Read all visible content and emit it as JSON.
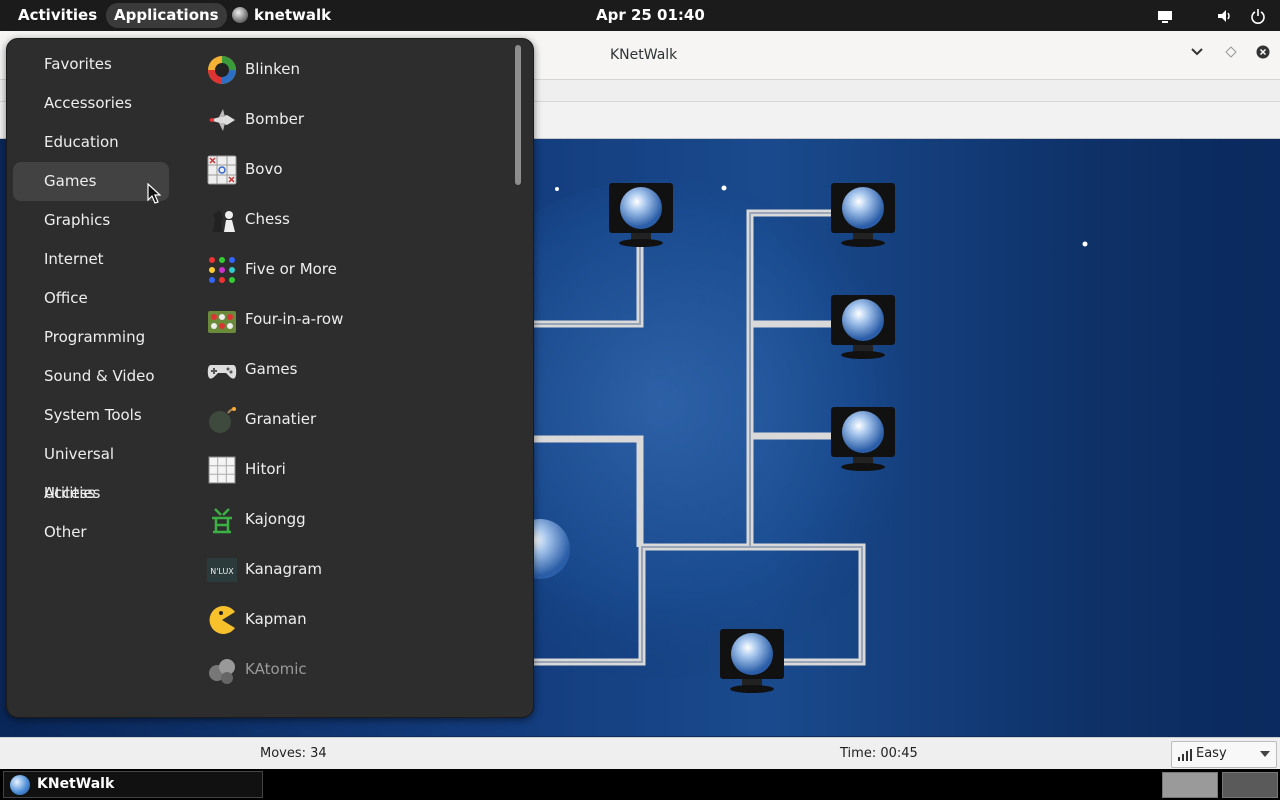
{
  "topbar": {
    "activities": "Activities",
    "applications": "Applications",
    "app_name": "knetwalk",
    "clock": "Apr 25  01:40"
  },
  "window": {
    "title": "KNetWalk",
    "minimize_icon": "chevron-down-icon",
    "maximize_icon": "diamond-icon",
    "close_icon": "close-icon"
  },
  "menu": {
    "categories": [
      "Favorites",
      "Accessories",
      "Education",
      "Games",
      "Graphics",
      "Internet",
      "Office",
      "Programming",
      "Sound & Video",
      "System Tools",
      "Universal Access",
      "Utilities",
      "Other"
    ],
    "selected_category": "Games",
    "apps": [
      "Blinken",
      "Bomber",
      "Bovo",
      "Chess",
      "Five or More",
      "Four-in-a-row",
      "Games",
      "Granatier",
      "Hitori",
      "Kajongg",
      "Kanagram",
      "Kapman",
      "KAtomic"
    ]
  },
  "status": {
    "moves": "Moves: 34",
    "time": "Time: 00:45",
    "difficulty": "Easy"
  },
  "taskbar": {
    "item": "KNetWalk"
  },
  "colors": {
    "topbar": "#1b1b1b",
    "menu_bg": "#2d2d2d",
    "menu_selected": "#424242",
    "board": "#133c7d"
  }
}
